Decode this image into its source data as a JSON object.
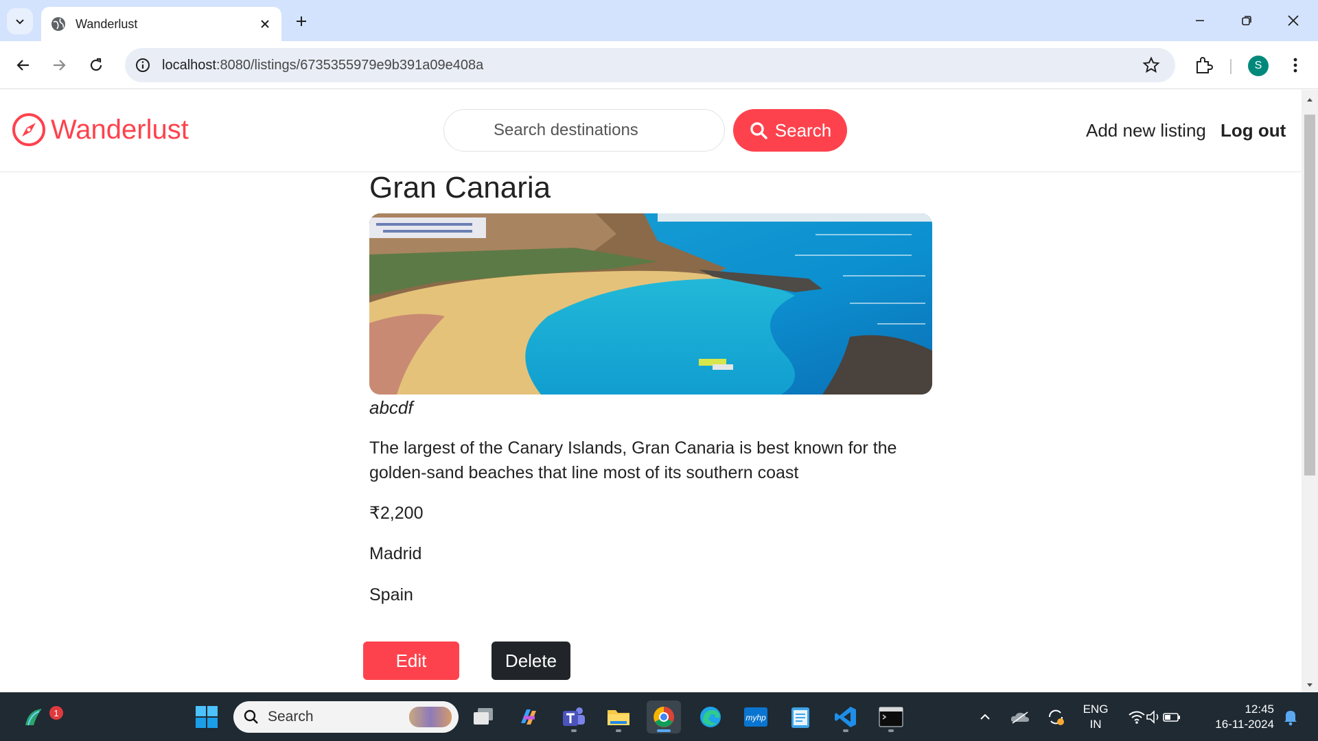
{
  "browser": {
    "tab_title": "Wanderlust",
    "url_host": "localhost",
    "url_path": ":8080/listings/6735355979e9b391a09e408a",
    "avatar_initial": "S"
  },
  "site": {
    "brand": "Wanderlust",
    "search_placeholder": "Search destinations",
    "search_button": "Search",
    "nav_add": "Add new listing",
    "nav_logout": "Log out",
    "brand_color": "#fe424d"
  },
  "listing": {
    "title": "Gran Canaria",
    "owner": "abcdf",
    "description": "The largest of the Canary Islands, Gran Canaria is best known for the golden-sand beaches that line most of its southern coast",
    "price": "₹2,200",
    "location": "Madrid",
    "country": "Spain",
    "image_alt": "beach-image",
    "edit_label": "Edit",
    "delete_label": "Delete"
  },
  "taskbar": {
    "search_text": "Search",
    "widget_badge": "1",
    "lang_line1": "ENG",
    "lang_line2": "IN",
    "time": "12:45",
    "date": "16-11-2024",
    "apps": [
      "start-icon",
      "task-view-icon",
      "copilot-icon",
      "teams-icon",
      "file-explorer-icon",
      "chrome-icon",
      "edge-icon",
      "myhp-icon",
      "notepad-icon",
      "vscode-icon",
      "terminal-icon"
    ]
  }
}
